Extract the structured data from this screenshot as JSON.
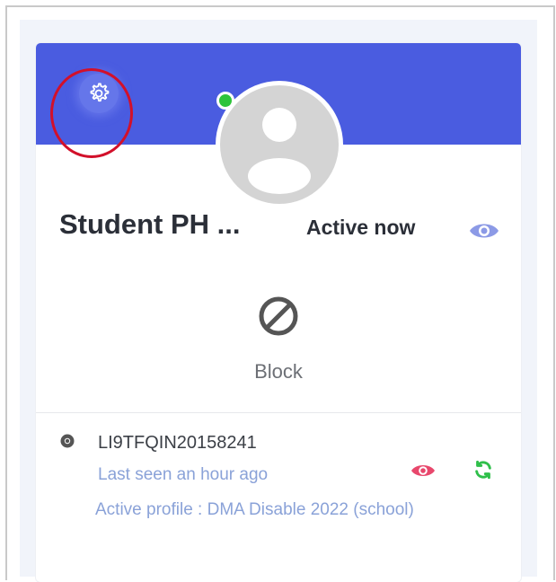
{
  "profile": {
    "name": "Student PH ...",
    "status": "Active now",
    "online": true
  },
  "actions": {
    "block_label": "Block"
  },
  "device": {
    "id": "LI9TFQIN20158241",
    "last_seen": "Last seen an hour ago",
    "active_profile": "Active profile : DMA Disable 2022 (school)"
  },
  "icons": {
    "settings": "gear-icon",
    "view_profile": "eye-icon",
    "block": "block-icon",
    "device": "chrome-icon",
    "device_view": "eye-icon",
    "refresh": "refresh-icon"
  },
  "colors": {
    "header": "#4a5ce0",
    "online": "#2ec43b",
    "highlight": "#d2102a",
    "secondary_text": "#8aa2d8",
    "device_eye": "#e8476c",
    "refresh": "#2fbf4a"
  }
}
